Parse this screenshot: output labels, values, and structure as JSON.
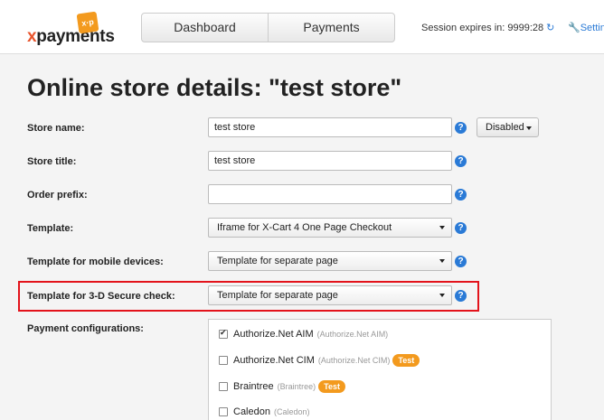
{
  "header": {
    "logo": {
      "x": "x",
      "rest": "payments",
      "badge": "x·p"
    },
    "nav": {
      "tabs": [
        {
          "label": "Dashboard"
        },
        {
          "label": "Payments"
        }
      ]
    },
    "session": {
      "text": "Session expires in: 9999:28",
      "refresh_icon": "↻"
    },
    "settings": {
      "icon": "🔧",
      "label": "Settin"
    }
  },
  "page": {
    "title": "Online store details: \"test store\""
  },
  "form": {
    "store_name": {
      "label": "Store name:",
      "value": "test store",
      "status": "Disabled"
    },
    "store_title": {
      "label": "Store title:",
      "value": "test store"
    },
    "order_prefix": {
      "label": "Order prefix:",
      "value": ""
    },
    "template": {
      "label": "Template:",
      "value": "Iframe for X-Cart 4 One Page Checkout"
    },
    "template_mobile": {
      "label": "Template for mobile devices:",
      "value": "Template for separate page"
    },
    "template_3ds": {
      "label": "Template for 3-D Secure check:",
      "value": "Template for separate page"
    },
    "help_glyph": "?"
  },
  "payments": {
    "label": "Payment configurations:",
    "items": [
      {
        "name": "Authorize.Net AIM",
        "sub": "(Authorize.Net AIM)",
        "checked": true,
        "badge": ""
      },
      {
        "name": "Authorize.Net CIM",
        "sub": "(Authorize.Net CIM)",
        "checked": false,
        "badge": "Test"
      },
      {
        "name": "Braintree",
        "sub": "(Braintree)",
        "checked": false,
        "badge": "Test"
      },
      {
        "name": "Caledon",
        "sub": "(Caledon)",
        "checked": false,
        "badge": ""
      }
    ]
  },
  "colors": {
    "accent": "#2a7ad6",
    "badge": "#f39a1e",
    "highlight": "#e3131b",
    "logo_x": "#e8542c"
  }
}
